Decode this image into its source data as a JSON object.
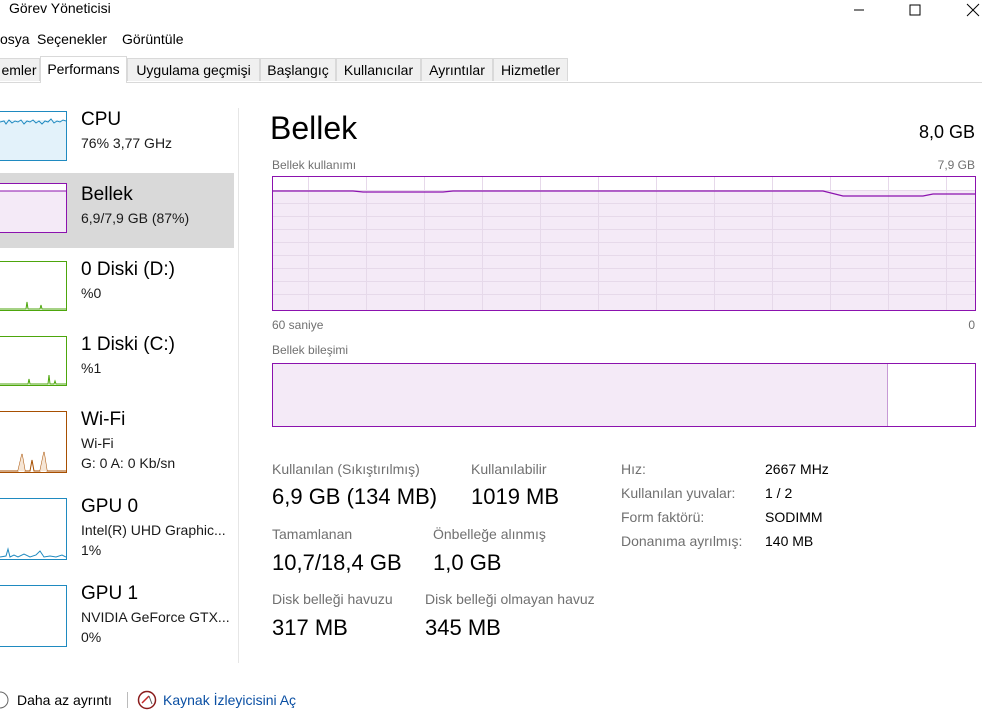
{
  "window": {
    "title": "Görev Yöneticisi"
  },
  "menu": {
    "items": [
      "osya",
      "Seçenekler",
      "Görüntüle"
    ]
  },
  "tabs": [
    "emler",
    "Performans",
    "Uygulama geçmişi",
    "Başlangıç",
    "Kullanıcılar",
    "Ayrıntılar",
    "Hizmetler"
  ],
  "sidebar": {
    "items": [
      {
        "name": "CPU",
        "line1": "76%  3,77 GHz",
        "line2": "",
        "color": "#1f8ac0"
      },
      {
        "name": "Bellek",
        "line1": "6,9/7,9 GB (87%)",
        "line2": "",
        "color": "#8b12ae"
      },
      {
        "name": "0 Diski (D:)",
        "line1": "%0",
        "line2": "",
        "color": "#4da60c"
      },
      {
        "name": "1 Diski (C:)",
        "line1": "%1",
        "line2": "",
        "color": "#4da60c"
      },
      {
        "name": "Wi-Fi",
        "line1": "Wi-Fi",
        "line2": "G: 0  A: 0 Kb/sn",
        "color": "#a74f01"
      },
      {
        "name": "GPU 0",
        "line1": "Intel(R) UHD Graphic...",
        "line2": "1%",
        "color": "#1f8ac0"
      },
      {
        "name": "GPU 1",
        "line1": "NVIDIA GeForce GTX...",
        "line2": "0%",
        "color": "#1f8ac0"
      }
    ]
  },
  "main": {
    "title": "Bellek",
    "total": "8,0 GB",
    "usage_label": "Bellek kullanımı",
    "usage_max": "7,9 GB",
    "time_left": "60 saniye",
    "time_right": "0",
    "composition_label": "Bellek bileşimi",
    "in_use_fraction": 0.874,
    "stats": {
      "in_use_label": "Kullanılan (Sıkıştırılmış)",
      "in_use_value": "6,9 GB (134 MB)",
      "available_label": "Kullanılabilir",
      "available_value": "1019 MB",
      "committed_label": "Tamamlanan",
      "committed_value": "10,7/18,4 GB",
      "cached_label": "Önbelleğe alınmış",
      "cached_value": "1,0 GB",
      "paged_label": "Disk belleği havuzu",
      "paged_value": "317 MB",
      "nonpaged_label": "Disk belleği olmayan havuz",
      "nonpaged_value": "345 MB"
    },
    "details": [
      {
        "label": "Hız:",
        "value": "2667 MHz"
      },
      {
        "label": "Kullanılan yuvalar:",
        "value": "1 / 2"
      },
      {
        "label": "Form faktörü:",
        "value": "SODIMM"
      },
      {
        "label": "Donanıma ayrılmış:",
        "value": "140 MB"
      }
    ]
  },
  "footer": {
    "fewer_details": "Daha az ayrıntı",
    "resource_monitor": "Kaynak İzleyicisini Aç"
  }
}
